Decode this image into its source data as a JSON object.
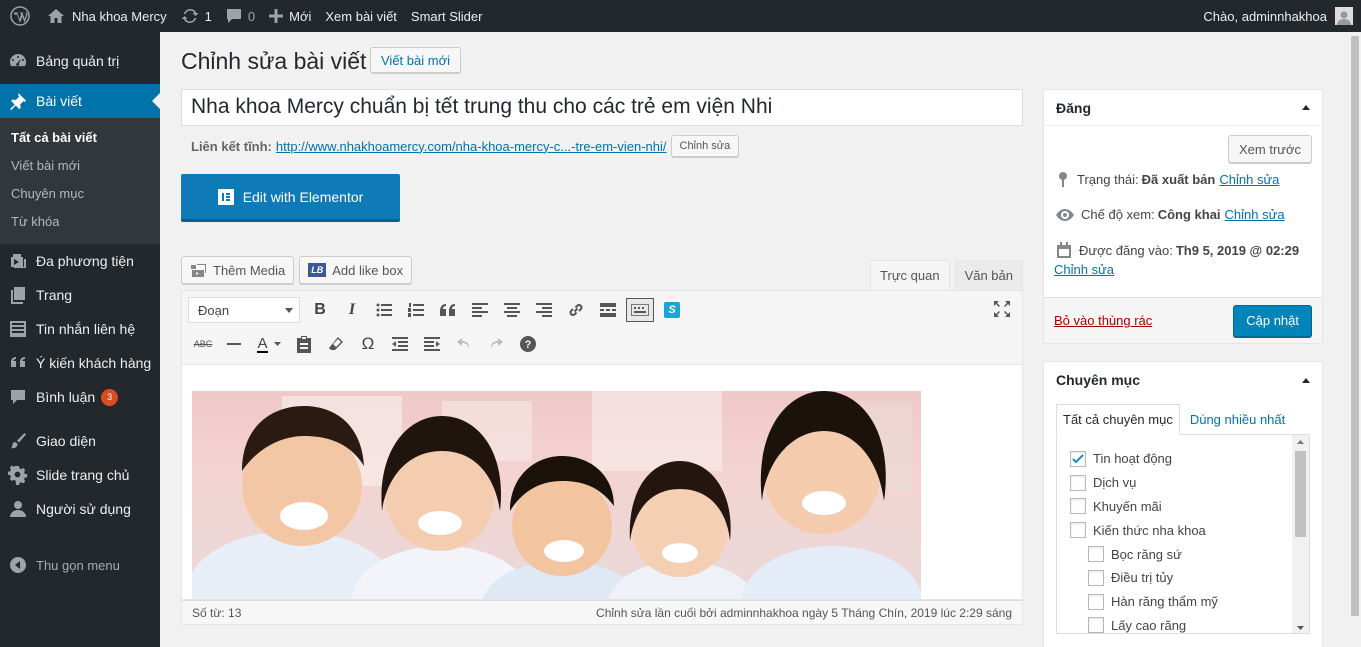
{
  "adminbar": {
    "site_name": "Nha khoa Mercy",
    "updates_count": "1",
    "comments_count": "0",
    "new_label": "Mới",
    "view_post_label": "Xem bài viết",
    "smart_slider_label": "Smart Slider",
    "greeting": "Chào, adminnhakhoa"
  },
  "sidebar": {
    "dashboard": "Bảng quản trị",
    "posts": "Bài viết",
    "sub": {
      "all_posts": "Tất cả bài viết",
      "add_new": "Viết bài mới",
      "categories": "Chuyên mục",
      "tags": "Từ khóa"
    },
    "media": "Đa phương tiện",
    "pages": "Trang",
    "contact": "Tin nhắn liên hệ",
    "testimonials": "Ý kiến khách hàng",
    "comments": "Bình luận",
    "comments_badge": "3",
    "appearance": "Giao diện",
    "slide": "Slide trang chủ",
    "users": "Người sử dụng",
    "collapse": "Thu gọn menu"
  },
  "page": {
    "title": "Chỉnh sửa bài viết",
    "add_new_button": "Viết bài mới",
    "post_title": "Nha khoa Mercy chuẩn bị tết trung thu cho các trẻ em viện Nhi",
    "permalink_label": "Liên kết tĩnh:",
    "permalink_url": "http://www.nhakhoamercy.com/nha-khoa-mercy-c...-tre-em-vien-nhi/",
    "permalink_edit": "Chỉnh sửa",
    "elementor_button": "Edit with Elementor"
  },
  "editor": {
    "add_media": "Thêm Media",
    "add_like_box": "Add like box",
    "tab_visual": "Trực quan",
    "tab_text": "Văn bản",
    "format_select": "Đoạn",
    "word_count": "Số từ: 13",
    "last_edit": "Chỉnh sửa lần cuối bởi adminnhakhoa ngày 5 Tháng Chín, 2019 lúc 2:29 sáng"
  },
  "publish": {
    "heading": "Đăng",
    "preview_button": "Xem trước",
    "status_label": "Trạng thái:",
    "status_value": "Đã xuất bản",
    "visibility_label": "Chế độ xem:",
    "visibility_value": "Công khai",
    "published_label": "Được đăng vào:",
    "published_value": "Th9 5, 2019 @ 02:29",
    "edit_link": "Chỉnh sửa",
    "trash_link": "Bỏ vào thùng rác",
    "update_button": "Cập nhật"
  },
  "categories": {
    "heading": "Chuyên mục",
    "tab_all": "Tất cả chuyên mục",
    "tab_popular": "Dùng nhiều nhất",
    "items": [
      {
        "label": "Tin hoạt động",
        "checked": true,
        "child": false
      },
      {
        "label": "Dịch vụ",
        "checked": false,
        "child": false
      },
      {
        "label": "Khuyến mãi",
        "checked": false,
        "child": false
      },
      {
        "label": "Kiến thức nha khoa",
        "checked": false,
        "child": false
      },
      {
        "label": "Bọc răng sứ",
        "checked": false,
        "child": true
      },
      {
        "label": "Điều trị tủy",
        "checked": false,
        "child": true
      },
      {
        "label": "Hàn răng thẩm mỹ",
        "checked": false,
        "child": true
      },
      {
        "label": "Lấy cao răng",
        "checked": false,
        "child": true
      }
    ]
  },
  "colors": {
    "admin_bar": "#23282d",
    "accent": "#0073aa",
    "primary_button": "#0085ba",
    "badge": "#d54e21"
  }
}
